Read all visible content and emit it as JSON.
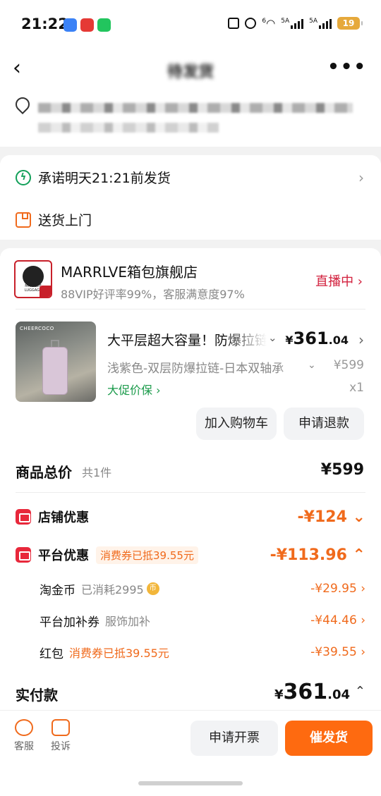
{
  "status": {
    "time": "21:22",
    "network1": "5A",
    "network2": "5A",
    "wifi_label": "6",
    "battery": "19"
  },
  "nav": {
    "title": "待发货"
  },
  "delivery": {
    "promise": "承诺明天21:21前发货",
    "method": "送货上门"
  },
  "shop": {
    "name": "MARRLVE箱包旗舰店",
    "rating": "88VIP好评率99%，客服满意度97%",
    "live": "直播中 ›",
    "logo_text": "MARRLVE LUGGAGE"
  },
  "product": {
    "title": "大平层超大容量！防爆拉链",
    "spec": "浅紫色-双层防爆拉链-日本双轴承",
    "price_symbol": "¥",
    "price_int": "361",
    "price_dec": ".04",
    "original_price": "¥599",
    "promo": "大促价保 ›",
    "qty": "x1",
    "brand_mark": "CHEERCOCO",
    "add_cart": "加入购物车",
    "refund": "申请退款"
  },
  "summary": {
    "total_label": "商品总价",
    "total_count": "共1件",
    "total_price": "¥599",
    "store_discount_label": "店铺优惠",
    "store_discount": "-¥124 ⌄",
    "platform_discount_label": "平台优惠",
    "platform_coupon_tag": "消费券已抵39.55元",
    "platform_discount": "-¥113.96 ⌃",
    "items": [
      {
        "label": "淘金币",
        "note": "已消耗2995",
        "amount": "-¥29.95 ›"
      },
      {
        "label": "平台加补券",
        "note": "服饰加补",
        "amount": "-¥44.46 ›"
      },
      {
        "label": "红包",
        "note": "消费券已抵39.55元",
        "amount": "-¥39.55 ›"
      }
    ],
    "paid_label": "实付款",
    "paid_symbol": "¥",
    "paid_int": "361",
    "paid_dec": ".04"
  },
  "bottom": {
    "service": "客服",
    "complain": "投诉",
    "invoice": "申请开票",
    "urge": "催发货"
  },
  "colors": {
    "accent_orange": "#f06a1c",
    "live_red": "#d21f3c",
    "promo_green": "#1a9a4a",
    "urge_button": "#fe6a10"
  }
}
